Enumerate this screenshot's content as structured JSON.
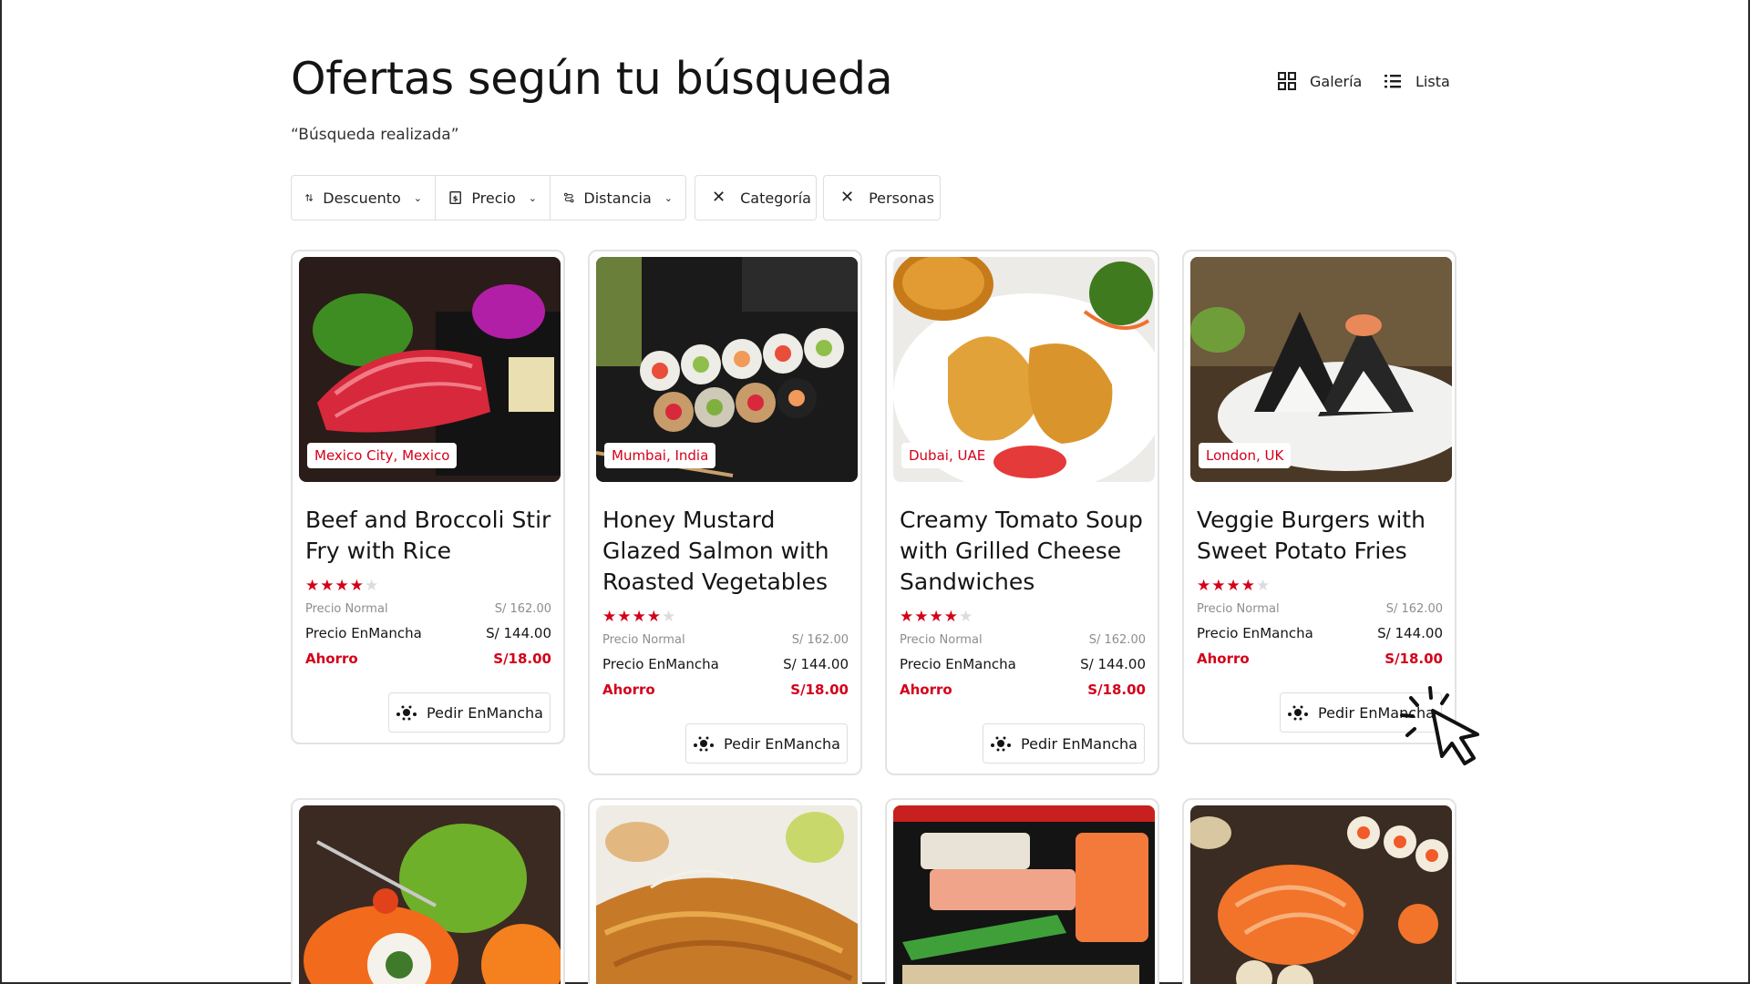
{
  "header": {
    "title": "Ofertas según tu búsqueda",
    "subtitle": "“Búsqueda realizada”"
  },
  "view_toggle": {
    "gallery_label": "Galería",
    "list_label": "Lista",
    "gallery_icon": "grid-icon",
    "list_icon": "list-icon"
  },
  "filters": {
    "sort": [
      {
        "label": "Descuento",
        "icon": "sort-arrows-icon"
      },
      {
        "label": "Precio",
        "icon": "price-tag-icon"
      },
      {
        "label": "Distancia",
        "icon": "route-icon"
      }
    ],
    "chips": [
      {
        "label": "Categoría",
        "icon": "close-icon"
      },
      {
        "label": "Personas",
        "icon": "close-icon"
      }
    ]
  },
  "colors": {
    "accent": "#d4001a",
    "border": "#dedede",
    "muted_text": "#8d8d8d"
  },
  "cards": [
    {
      "location": "Mexico City, Mexico",
      "title": "Beef and Broccoli Stir Fry with Rice",
      "rating": 4.5,
      "normal_label": "Precio Normal",
      "normal_price": "S/ 162.00",
      "enmancha_label": "Precio EnMancha",
      "enmancha_price": "S/ 144.00",
      "savings_label": "Ahorro",
      "savings_value": "S/18.00",
      "button_label": "Pedir EnMancha"
    },
    {
      "location": "Mumbai, India",
      "title": "Honey Mustard Glazed Salmon with Roasted Vegetables",
      "rating": 4.5,
      "normal_label": "Precio Normal",
      "normal_price": "S/ 162.00",
      "enmancha_label": "Precio EnMancha",
      "enmancha_price": "S/ 144.00",
      "savings_label": "Ahorro",
      "savings_value": "S/18.00",
      "button_label": "Pedir EnMancha"
    },
    {
      "location": "Dubai, UAE",
      "title": "Creamy Tomato Soup with Grilled Cheese Sandwiches",
      "rating": 4.5,
      "normal_label": "Precio Normal",
      "normal_price": "S/ 162.00",
      "enmancha_label": "Precio EnMancha",
      "enmancha_price": "S/ 144.00",
      "savings_label": "Ahorro",
      "savings_value": "S/18.00",
      "button_label": "Pedir EnMancha"
    },
    {
      "location": "London, UK",
      "title": "Veggie Burgers with Sweet Potato Fries",
      "rating": 4.5,
      "normal_label": "Precio Normal",
      "normal_price": "S/ 162.00",
      "enmancha_label": "Precio EnMancha",
      "enmancha_price": "S/ 144.00",
      "savings_label": "Ahorro",
      "savings_value": "S/18.00",
      "button_label": "Pedir EnMancha"
    }
  ]
}
